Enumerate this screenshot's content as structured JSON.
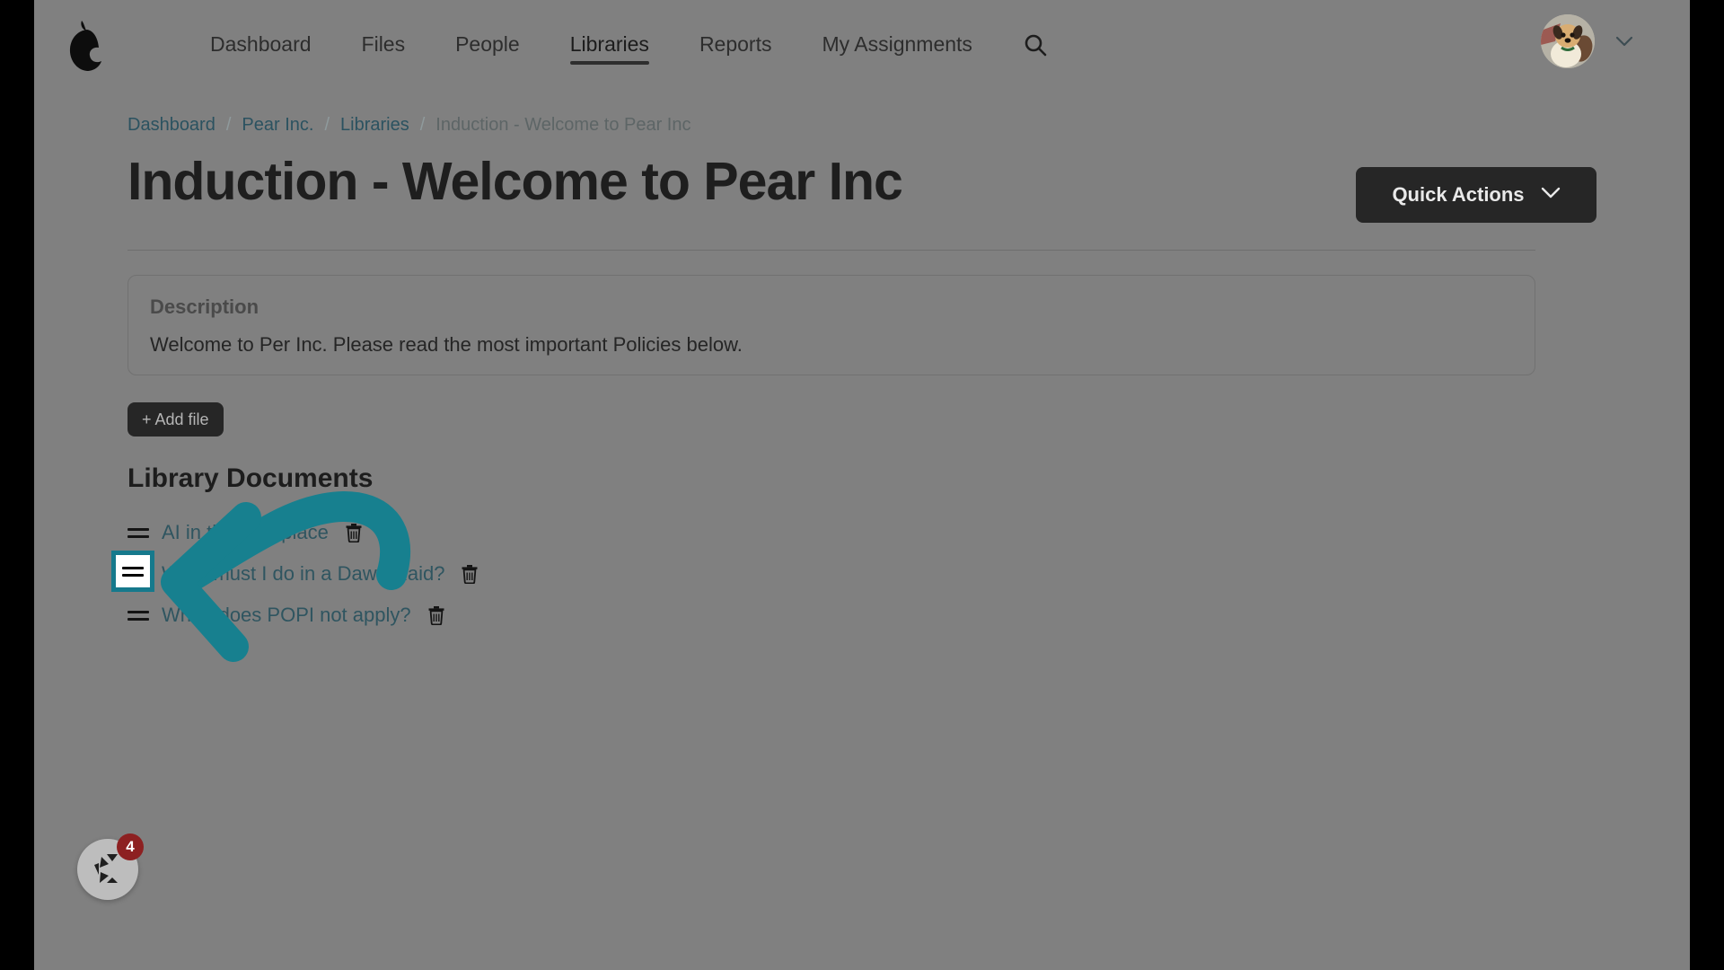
{
  "nav": {
    "logo_icon": "pear-logo-icon",
    "links": [
      {
        "label": "Dashboard",
        "active": false
      },
      {
        "label": "Files",
        "active": false
      },
      {
        "label": "People",
        "active": false
      },
      {
        "label": "Libraries",
        "active": true
      },
      {
        "label": "Reports",
        "active": false
      },
      {
        "label": "My Assignments",
        "active": false
      }
    ],
    "search_icon": "search-icon",
    "avatar_icon": "user-avatar-dog-photo",
    "account_caret_icon": "chevron-down-icon"
  },
  "breadcrumb": {
    "items": [
      "Dashboard",
      "Pear Inc.",
      "Libraries"
    ],
    "separator": "/",
    "current": "Induction - Welcome to Pear Inc"
  },
  "header": {
    "title": "Induction - Welcome to Pear Inc",
    "quick_actions_label": "Quick Actions",
    "quick_actions_caret_icon": "chevron-down-icon"
  },
  "description": {
    "title": "Description",
    "body": "Welcome to Per Inc. Please read the most important Policies below."
  },
  "add_file": {
    "label": "+ Add file"
  },
  "documents": {
    "heading": "Library Documents",
    "items": [
      {
        "name": "AI in the workplace",
        "handle_icon": "drag-handle-icon",
        "delete_icon": "trash-icon"
      },
      {
        "name": "What must I do in a Dawn Raid?",
        "handle_icon": "drag-handle-icon",
        "delete_icon": "trash-icon"
      },
      {
        "name": "When does POPI not apply?",
        "handle_icon": "drag-handle-icon",
        "delete_icon": "trash-icon"
      }
    ]
  },
  "annotation": {
    "arrow_color": "#17808f",
    "highlight_color": "#16798c",
    "target": "drag-handle of third library document"
  },
  "help_widget": {
    "icon": "support-widget-icon",
    "badge_count": "4",
    "badge_color": "#8d2021"
  },
  "colors": {
    "overlay_background": "#808080",
    "link_text": "#2f5560",
    "dark_button": "#262626",
    "accent_teal": "#17808f"
  }
}
